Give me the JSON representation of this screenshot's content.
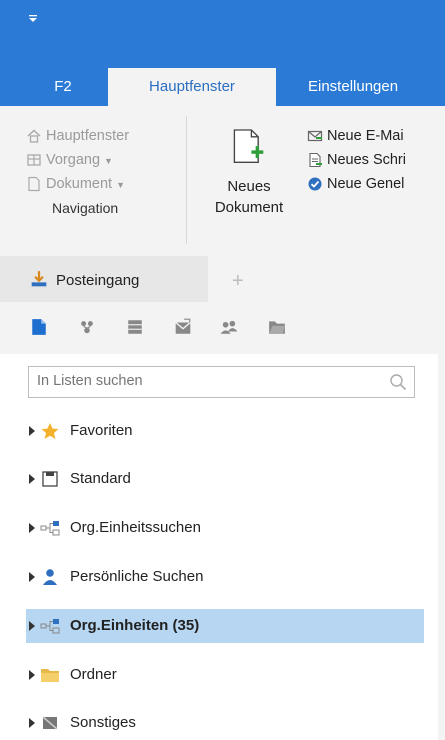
{
  "app": {
    "colors": {
      "titlebar": "#2b7bd6",
      "ribbon_bg": "#f3f3f3",
      "selection": "#b6d6f2"
    },
    "qa_icon": "dropdown-arrow-icon"
  },
  "tabs": [
    {
      "label": "F2",
      "active": false
    },
    {
      "label": "Hauptfenster",
      "active": true
    },
    {
      "label": "Einstellungen",
      "active": false
    }
  ],
  "navigation": {
    "items": [
      {
        "label": "Hauptfenster",
        "icon": "home-icon"
      },
      {
        "label": "Vorgang",
        "icon": "vorgang-icon"
      },
      {
        "label": "Dokument",
        "icon": "document-icon"
      }
    ],
    "group_label": "Navigation"
  },
  "new_document": {
    "line1": "Neues",
    "line2": "Dokument",
    "icon": "new-document-icon"
  },
  "new_items": [
    {
      "label": "Neue E-Mai",
      "icon": "email-icon"
    },
    {
      "label": "Neues Schri",
      "icon": "letter-icon"
    },
    {
      "label": "Neue Genel",
      "icon": "approval-icon"
    }
  ],
  "panel": {
    "tab_label": "Posteingang",
    "add_tab": "+"
  },
  "search": {
    "placeholder": "In Listen suchen"
  },
  "tree": [
    {
      "label": "Favoriten",
      "icon": "star-icon",
      "selected": false
    },
    {
      "label": "Standard",
      "icon": "standard-icon",
      "selected": false
    },
    {
      "label": "Org.Einheitssuchen",
      "icon": "org-unit-icon",
      "selected": false
    },
    {
      "label": "Persönliche Suchen",
      "icon": "person-icon",
      "selected": false
    },
    {
      "label": "Org.Einheiten (35)",
      "icon": "org-unit-icon",
      "selected": true
    },
    {
      "label": "Ordner",
      "icon": "folder-icon",
      "selected": false
    },
    {
      "label": "Sonstiges",
      "icon": "misc-icon",
      "selected": false
    }
  ]
}
